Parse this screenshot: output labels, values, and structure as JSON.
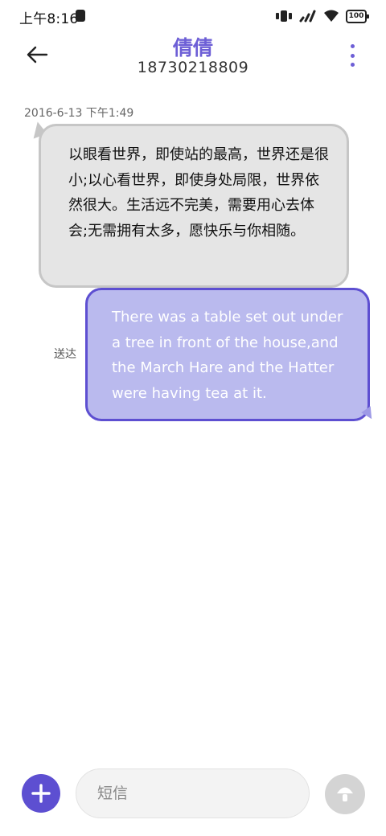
{
  "status_bar": {
    "time": "上午8:16",
    "battery": "100"
  },
  "header": {
    "contact_name": "倩倩",
    "contact_number": "18730218809"
  },
  "conversation": {
    "received": {
      "timestamp": "2016-6-13 下午1:49",
      "text": "以眼看世界，即使站的最高，世界还是很小;以心看世界，即使身处局限，世界依然很大。生活远不完美，需要用心去体会;无需拥有太多，愿快乐与你相随。"
    },
    "sent": {
      "status": "送达",
      "text": "There was a table set out under a tree in front of the house,and the March Hare and the Hatter were having tea at it."
    }
  },
  "composer": {
    "placeholder": "短信"
  },
  "colors": {
    "accent": "#5d4fd1",
    "name": "#6d5fd6",
    "sent_bubble": "#babaee",
    "received_bubble": "#e5e5e5"
  },
  "icons": {
    "back": "back-arrow-icon",
    "more": "more-vertical-icon",
    "add": "plus-icon",
    "send": "send-icon",
    "signal": "signal-icon",
    "wifi": "wifi-icon",
    "battery": "battery-icon"
  }
}
